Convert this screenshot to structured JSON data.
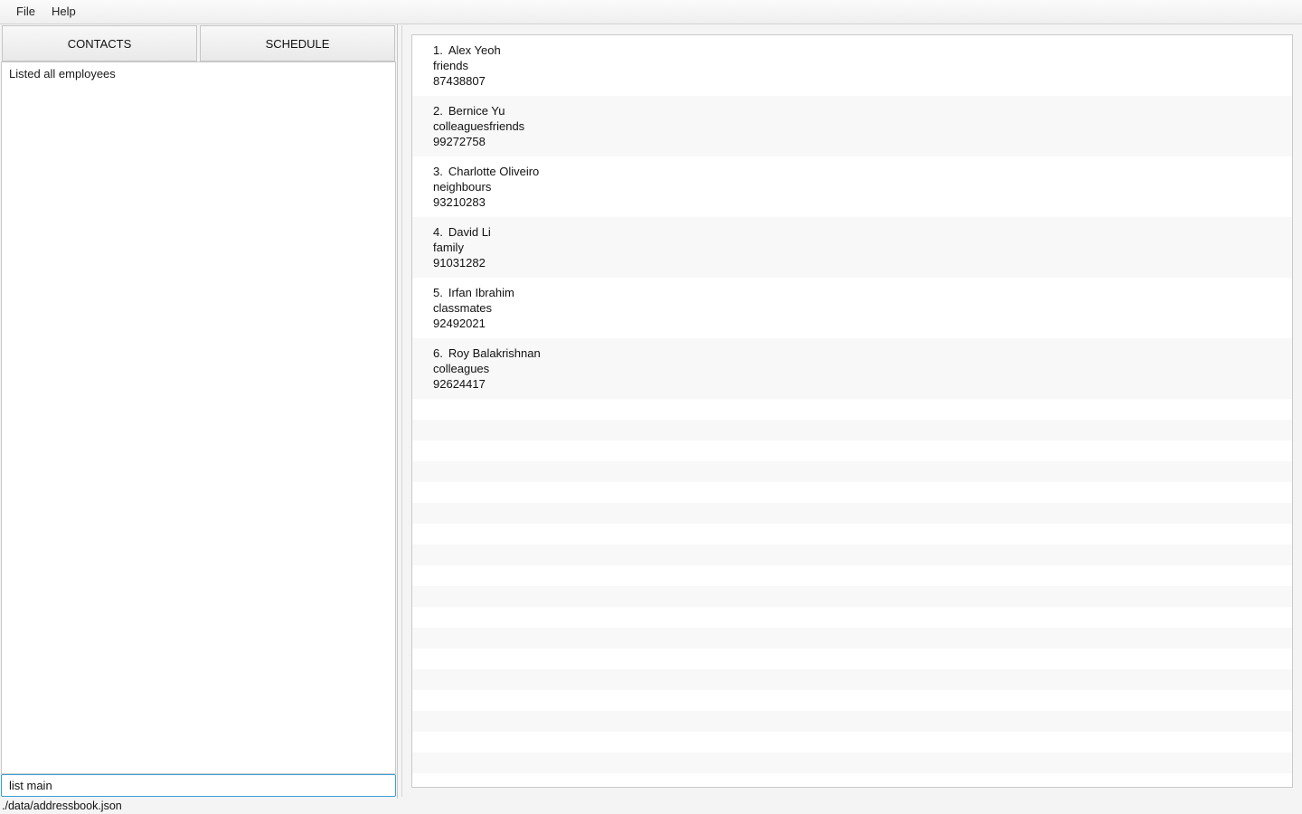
{
  "menu": {
    "file": "File",
    "help": "Help"
  },
  "tabs": {
    "contacts": "CONTACTS",
    "schedule": "SCHEDULE"
  },
  "result_display": {
    "text": "Listed all employees"
  },
  "command_box": {
    "value": "list main"
  },
  "status_bar": {
    "path": "./data/addressbook.json"
  },
  "persons": [
    {
      "index": "1.",
      "name": "Alex Yeoh",
      "tags": "friends",
      "phone": "87438807"
    },
    {
      "index": "2.",
      "name": "Bernice Yu",
      "tags": "colleaguesfriends",
      "phone": "99272758"
    },
    {
      "index": "3.",
      "name": "Charlotte Oliveiro",
      "tags": "neighbours",
      "phone": "93210283"
    },
    {
      "index": "4.",
      "name": "David Li",
      "tags": "family",
      "phone": "91031282"
    },
    {
      "index": "5.",
      "name": "Irfan Ibrahim",
      "tags": "classmates",
      "phone": "92492021"
    },
    {
      "index": "6.",
      "name": "Roy Balakrishnan",
      "tags": "colleagues",
      "phone": "92624417"
    }
  ]
}
